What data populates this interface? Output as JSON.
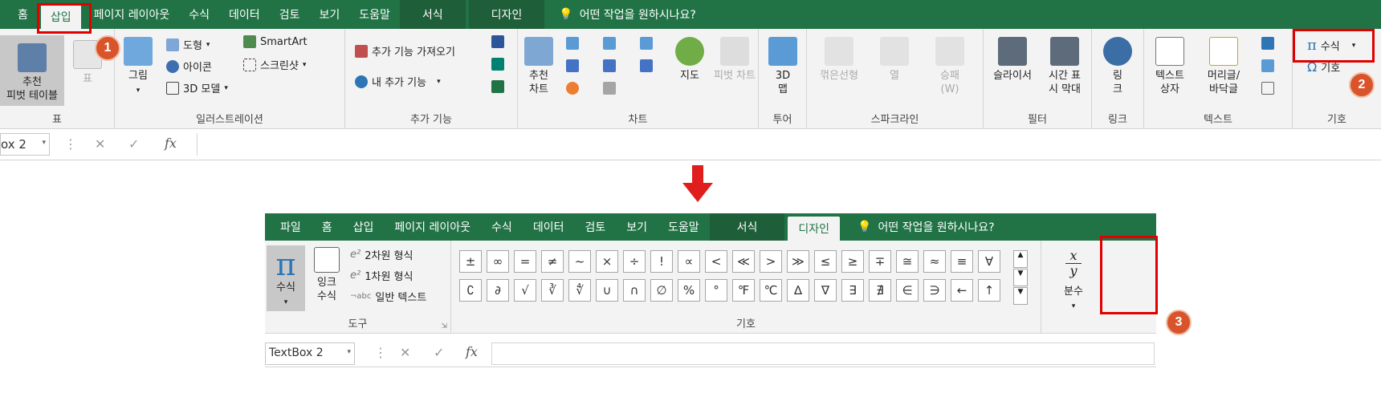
{
  "top": {
    "tabs": [
      "홈",
      "삽입",
      "페이지 레이아웃",
      "수식",
      "데이터",
      "검토",
      "보기",
      "도움말",
      "서식",
      "디자인"
    ],
    "tell_me": "어떤 작업을 원하시나요?",
    "groups": {
      "tables": {
        "label": "표",
        "pivot": "추천\n피벗 테이블",
        "table": "표"
      },
      "illustrations": {
        "label": "일러스트레이션",
        "picture": "그림",
        "shapes": "도형",
        "icons": "아이콘",
        "models": "3D 모델",
        "smartart": "SmartArt",
        "screenshot": "스크린샷"
      },
      "addins": {
        "label": "추가 기능",
        "get": "추가 기능 가져오기",
        "my": "내 추가 기능"
      },
      "charts": {
        "label": "차트",
        "recommended": "추천\n차트",
        "maps": "지도",
        "pivotchart": "피벗 차트"
      },
      "tours": {
        "label": "투어",
        "map3d": "3D\n맵"
      },
      "sparklines": {
        "label": "스파크라인",
        "line": "꺾은선형",
        "column": "열",
        "winloss": "승패\n(W)"
      },
      "filters": {
        "label": "필터",
        "slicer": "슬라이서",
        "timeline": "시간 표\n시 막대"
      },
      "links": {
        "label": "링크",
        "link": "링\n크"
      },
      "text": {
        "label": "텍스트",
        "textbox": "텍스트\n상자",
        "headerfooter": "머리글/\n바닥글"
      },
      "symbols": {
        "label": "기호",
        "equation": "수식",
        "symbol": "기호"
      }
    },
    "namebox": "ox 2",
    "fx": "fx"
  },
  "callouts": [
    "1",
    "2",
    "3"
  ],
  "bottom": {
    "tabs": [
      "파일",
      "홈",
      "삽입",
      "페이지 레이아웃",
      "수식",
      "데이터",
      "검토",
      "보기",
      "도움말",
      "서식",
      "디자인"
    ],
    "tell_me": "어떤 작업을 원하시나요?",
    "tools": {
      "label": "도구",
      "equation": "수식",
      "ink": "잉크\n수식",
      "professional": "2차원 형식",
      "linear": "1차원 형식",
      "normal": "일반 텍스트"
    },
    "symbols_label": "기호",
    "symbols_row1": [
      "±",
      "∞",
      "=",
      "≠",
      "~",
      "×",
      "÷",
      "!",
      "∝",
      "<",
      "≪",
      ">",
      "≫",
      "≤",
      "≥",
      "∓",
      "≅",
      "≈",
      "≡",
      "∀"
    ],
    "symbols_row2": [
      "∁",
      "∂",
      "√",
      "∛",
      "∜",
      "∪",
      "∩",
      "∅",
      "%",
      "°",
      "℉",
      "℃",
      "∆",
      "∇",
      "∃",
      "∄",
      "∈",
      "∋",
      "←",
      "↑"
    ],
    "fraction": {
      "num": "x",
      "den": "y",
      "label": "분수"
    },
    "namebox": "TextBox 2",
    "fx": "fx"
  },
  "colors": {
    "brand": "#217346",
    "callout": "#d9542a",
    "highlight": "#e00000"
  }
}
